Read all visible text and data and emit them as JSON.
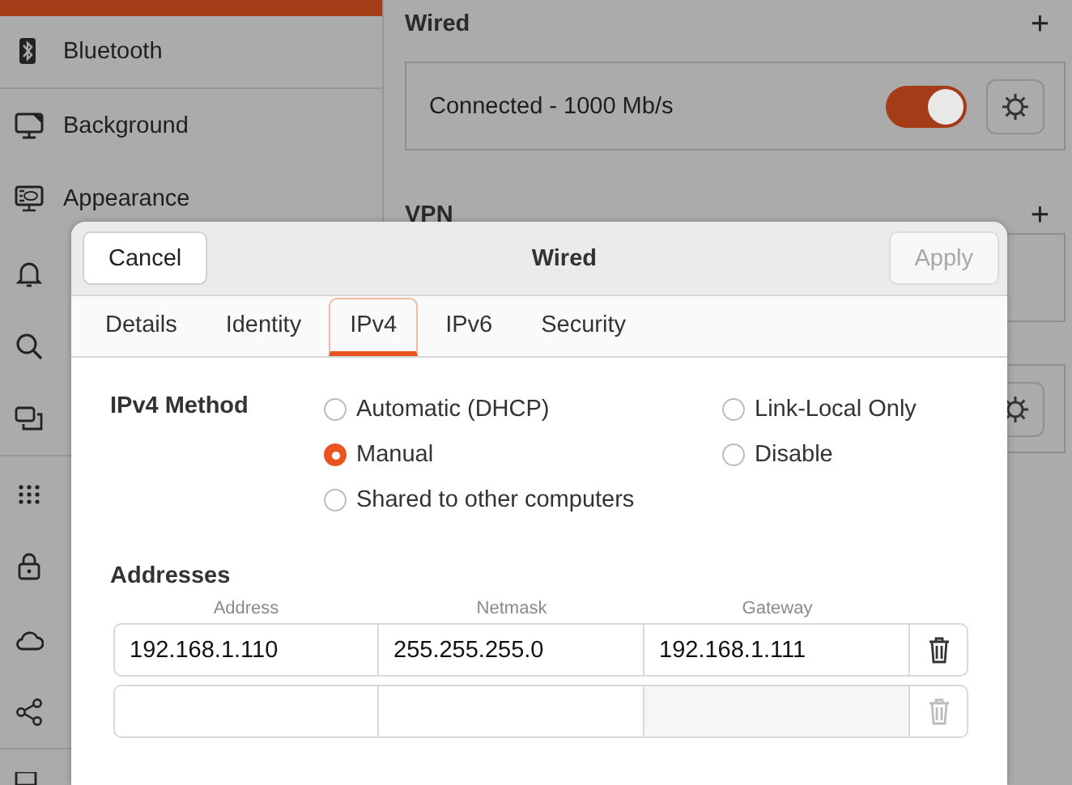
{
  "sidebar": {
    "items": [
      {
        "label": "Bluetooth",
        "selected": false
      },
      {
        "label": "Background",
        "selected": false
      },
      {
        "label": "Appearance",
        "selected": false
      },
      {
        "selected": false
      },
      {
        "selected": false
      },
      {
        "selected": false
      },
      {
        "selected": false
      },
      {
        "selected": false
      },
      {
        "selected": false
      },
      {
        "selected": false
      }
    ]
  },
  "wired": {
    "title": "Wired",
    "add": "+",
    "connection": {
      "status": "Connected - 1000 Mb/s",
      "on": true
    }
  },
  "vpn": {
    "title": "VPN",
    "add": "+"
  },
  "dialog": {
    "title": "Wired",
    "cancel": "Cancel",
    "apply": {
      "label": "Apply",
      "disabled": true
    },
    "tabs": [
      {
        "label": "Details",
        "selected": false
      },
      {
        "label": "Identity",
        "selected": false
      },
      {
        "label": "IPv4",
        "selected": true
      },
      {
        "label": "IPv6",
        "selected": false
      },
      {
        "label": "Security",
        "selected": false
      }
    ],
    "method_label": "IPv4 Method",
    "methods": [
      {
        "label": "Automatic (DHCP)",
        "selected": false
      },
      {
        "label": "Manual",
        "selected": true
      },
      {
        "label": "Shared to other computers",
        "selected": false
      },
      {
        "label": "Link-Local Only",
        "selected": false
      },
      {
        "label": "Disable",
        "selected": false
      }
    ],
    "addresses": {
      "title": "Addresses",
      "columns": [
        "Address",
        "Netmask",
        "Gateway"
      ],
      "rows": [
        {
          "values": [
            "192.168.1.110",
            "255.255.255.0",
            "192.168.1.111"
          ],
          "delete_disabled": false
        },
        {
          "delete_disabled": true
        }
      ]
    }
  }
}
